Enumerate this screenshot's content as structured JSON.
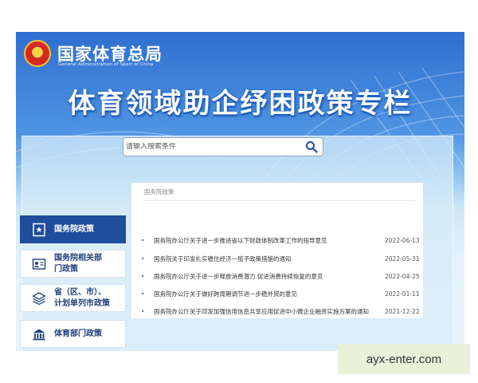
{
  "header": {
    "org_name": "国家体育总局",
    "org_name_en": "General Administration of Sport of China",
    "emblem_glyph": "★",
    "banner_title": "体育领域助企纾困政策专栏"
  },
  "search": {
    "placeholder": "请输入搜索条件",
    "icon": "search-icon"
  },
  "sidebar": {
    "items": [
      {
        "label": "国务院政策",
        "icon": "document-star-icon",
        "active": true
      },
      {
        "label": "国务院相关部门政策",
        "icon": "department-id-icon",
        "active": false
      },
      {
        "label": "省（区、市）、计划单列市政策",
        "icon": "layers-icon",
        "active": false
      },
      {
        "label": "体育部门政策",
        "icon": "building-icon",
        "active": false
      }
    ],
    "lines": [
      [
        "国务院政策"
      ],
      [
        "国务院相关部",
        "门政策"
      ],
      [
        "省（区、市）、",
        "计划单列市政策"
      ],
      [
        "体育部门政策"
      ]
    ]
  },
  "policy_list": {
    "header": "国务院政策",
    "items": [
      {
        "title": "国务院办公厅关于进一步推进省以下财政体制改革工作的指导意见",
        "date": "2022-06-13"
      },
      {
        "title": "国务院关于印发扎实稳住经济一揽子政策措施的通知",
        "date": "2022-05-31"
      },
      {
        "title": "国务院办公厅关于进一步释放消费潜力 促进消费持续恢复的意见",
        "date": "2022-04-25"
      },
      {
        "title": "国务院办公厅关于做好跨周期调节进一步稳外贸的意见",
        "date": "2022-01-11"
      },
      {
        "title": "国务院办公厅关于印发加强信用信息共享应用促进中小微企业融资实施方案的通知",
        "date": "2021-12-22"
      }
    ],
    "bullet": "•"
  },
  "watermark": "ayx-enter.com"
}
